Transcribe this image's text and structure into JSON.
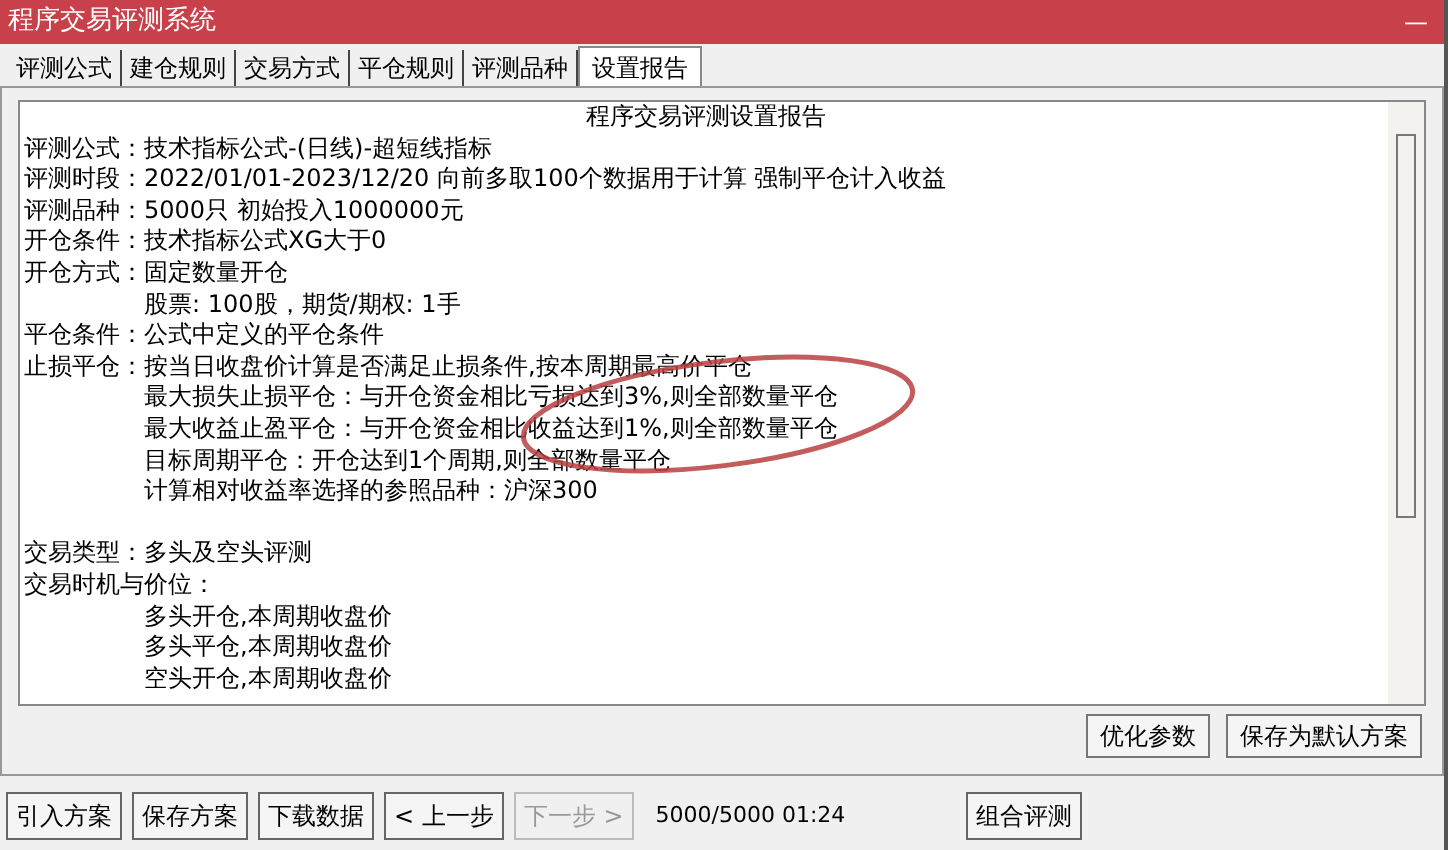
{
  "window": {
    "title": "程序交易评测系统",
    "minimize": "—"
  },
  "tabs": [
    {
      "label": "评测公式",
      "selected": false
    },
    {
      "label": "建仓规则",
      "selected": false
    },
    {
      "label": "交易方式",
      "selected": false
    },
    {
      "label": "平仓规则",
      "selected": false
    },
    {
      "label": "评测品种",
      "selected": false
    },
    {
      "label": "设置报告",
      "selected": true
    }
  ],
  "report": {
    "title": "程序交易评测设置报告",
    "lines": [
      {
        "kind": "field",
        "label": "评测公式：",
        "text": "技术指标公式-(日线)-超短线指标"
      },
      {
        "kind": "field",
        "label": "评测时段：",
        "text": "2022/01/01-2023/12/20 向前多取100个数据用于计算 强制平仓计入收益"
      },
      {
        "kind": "field",
        "label": "评测品种：",
        "text": "5000只 初始投入1000000元"
      },
      {
        "kind": "field",
        "label": "开仓条件：",
        "text": "技术指标公式XG大于0"
      },
      {
        "kind": "field",
        "label": "开仓方式：",
        "text": "固定数量开仓"
      },
      {
        "kind": "detail",
        "text": "股票: 100股，期货/期权: 1手"
      },
      {
        "kind": "field",
        "label": "平仓条件：",
        "text": "公式中定义的平仓条件"
      },
      {
        "kind": "field",
        "label": "止损平仓：",
        "text": "按当日收盘价计算是否满足止损条件,按本周期最高价平仓"
      },
      {
        "kind": "detail",
        "text": "最大损失止损平仓：与开仓资金相比亏损达到3%,则全部数量平仓"
      },
      {
        "kind": "detail",
        "text": "最大收益止盈平仓：与开仓资金相比收益达到1%,则全部数量平仓"
      },
      {
        "kind": "detail",
        "text": "目标周期平仓：开仓达到1个周期,则全部数量平仓"
      },
      {
        "kind": "detail",
        "text": "计算相对收益率选择的参照品种：沪深300"
      },
      {
        "kind": "blank"
      },
      {
        "kind": "field",
        "label": "交易类型：",
        "text": "多头及空头评测"
      },
      {
        "kind": "field",
        "label": "交易时机与价位："
      },
      {
        "kind": "detail",
        "text": "多头开仓,本周期收盘价"
      },
      {
        "kind": "detail",
        "text": "多头平仓,本周期收盘价"
      },
      {
        "kind": "detail",
        "text": "空头开仓,本周期收盘价"
      }
    ]
  },
  "panel_buttons": [
    "优化参数",
    "保存为默认方案"
  ],
  "toolbar": [
    {
      "label": "引入方案",
      "disabled": false
    },
    {
      "label": "保存方案",
      "disabled": false
    },
    {
      "label": "下载数据",
      "disabled": false
    },
    {
      "label": "< 上一步",
      "disabled": false
    },
    {
      "label": "下一步 >",
      "disabled": true
    }
  ],
  "status": "5000/5000 01:24",
  "right_buttons": [
    "组合评测"
  ]
}
